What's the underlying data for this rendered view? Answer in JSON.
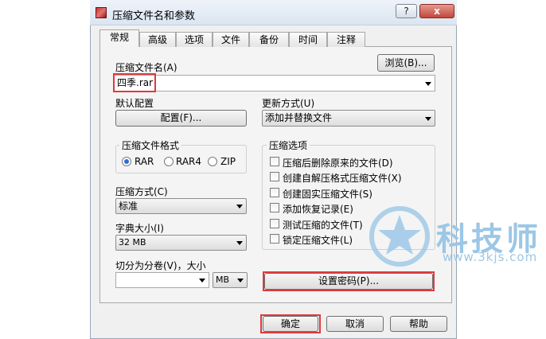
{
  "window": {
    "title": "压缩文件名和参数",
    "help_glyph": "?",
    "close_glyph": "x"
  },
  "tabs": [
    "常规",
    "高级",
    "选项",
    "文件",
    "备份",
    "时间",
    "注释"
  ],
  "archive": {
    "label": "压缩文件名(A)",
    "value": "四季.rar",
    "browse": "浏览(B)..."
  },
  "profile": {
    "label": "默认配置",
    "button": "配置(F)..."
  },
  "update": {
    "label": "更新方式(U)",
    "value": "添加并替换文件"
  },
  "format": {
    "label": "压缩文件格式",
    "options": [
      "RAR",
      "RAR4",
      "ZIP"
    ],
    "selected": "RAR"
  },
  "options": {
    "label": "压缩选项",
    "items": [
      "压缩后删除原来的文件(D)",
      "创建自解压格式压缩文件(X)",
      "创建固实压缩文件(S)",
      "添加恢复记录(E)",
      "测试压缩的文件(T)",
      "锁定压缩文件(L)"
    ]
  },
  "method": {
    "label": "压缩方式(C)",
    "value": "标准"
  },
  "dictionary": {
    "label": "字典大小(I)",
    "value": "32 MB"
  },
  "split": {
    "label": "切分为分卷(V)，大小",
    "value": "",
    "unit": "MB"
  },
  "password": {
    "button": "设置密码(P)..."
  },
  "footer": {
    "ok": "确定",
    "cancel": "取消",
    "help": "帮助"
  },
  "watermark": {
    "text": "科技师",
    "url": "www.3kjs.com"
  },
  "colors": {
    "highlight": "#e0393d",
    "watermark": "#9cc7e6"
  }
}
